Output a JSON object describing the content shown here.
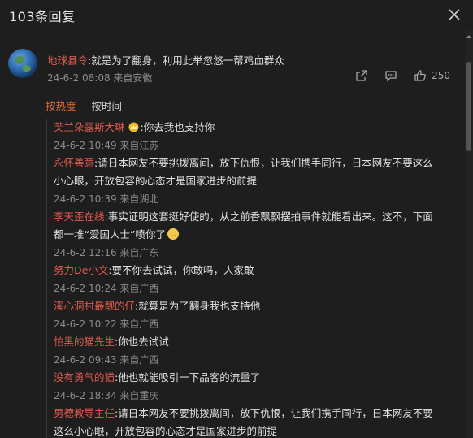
{
  "header": {
    "title": "103条回复"
  },
  "post": {
    "username": "地球县令",
    "text": ":就是为了翻身，利用此举忽悠一帮鸡血群众",
    "meta": "24-6-2 08:08 来自安徽",
    "like_count": "250"
  },
  "sort": {
    "hot_label": "按热度",
    "time_label": "按时间"
  },
  "replies": [
    {
      "username": "芙兰朵露斯大琳",
      "text": ":你去我也支持你",
      "meta": "24-6-2 10:49 来自江苏"
    },
    {
      "username": "永怀善意",
      "text": ":请日本网友不要挑拨离间，放下仇恨，让我们携手同行，日本网友不要这么",
      "text2": "小心眼，开放包容的心态才是国家进步的前提",
      "meta": "24-6-2 10:39 来自湖北"
    },
    {
      "username": "李天歪在线",
      "text": ":事实证明这套挺好使的，从之前香飘飘摆拍事件就能看出来。这不，下面",
      "text2": "都一堆“爱国人士”喷你了",
      "meta": "24-6-2 12:16 来自广东"
    },
    {
      "username": "努力De小文",
      "text": ":要不你去试试，你敢吗，人家敢",
      "meta": "24-6-2 10:24 来自广西"
    },
    {
      "username": "溪心洞村最靓的仔",
      "text": ":就算是为了翻身我也支持他",
      "meta": "24-6-2 10:22 来自广西"
    },
    {
      "username": "怕黑的猫先生",
      "text": ":你也去试试",
      "meta": "24-6-2 09:43 来自广西"
    },
    {
      "username": "没有勇气的猫",
      "text": ":他也就能吸引一下品客的流量了",
      "meta": "24-6-2 18:34 来自重庆"
    },
    {
      "username": "男德教导主任",
      "text": ":请日本网友不要挑拨离间，放下仇恨，让我们携手同行，日本网友不要",
      "text2": "这么小心眼，开放包容的心态才是国家进步的前提",
      "meta": ""
    }
  ]
}
